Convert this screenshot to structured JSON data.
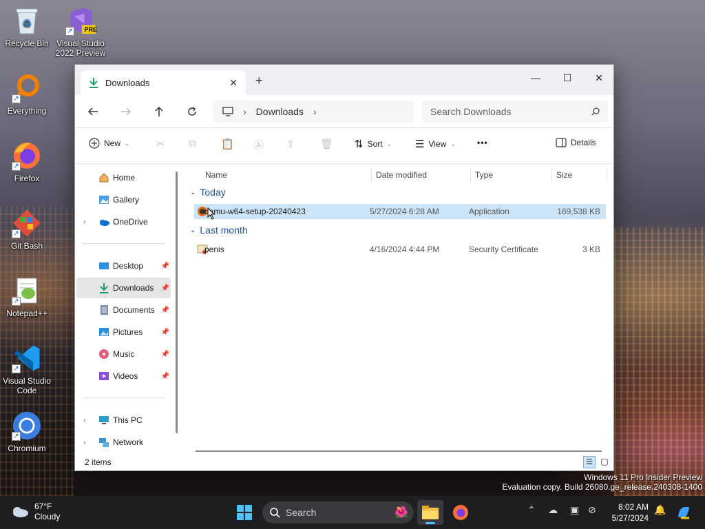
{
  "desktop": {
    "icons": [
      {
        "label": "Recycle Bin",
        "icon": "recycle-bin-icon"
      },
      {
        "label": "Visual Studio 2022 Preview",
        "icon": "visual-studio-icon",
        "badge": "PRE"
      },
      {
        "label": "Everything",
        "icon": "everything-search-icon"
      },
      {
        "label": "Firefox",
        "icon": "firefox-icon"
      },
      {
        "label": "Git Bash",
        "icon": "git-bash-icon"
      },
      {
        "label": "Notepad++",
        "icon": "notepad-plus-plus-icon"
      },
      {
        "label": "Visual Studio Code",
        "icon": "vscode-icon"
      },
      {
        "label": "Chromium",
        "icon": "chromium-icon"
      }
    ]
  },
  "window": {
    "tab_label": "Downloads",
    "tab_close": "✕",
    "new_tab": "+",
    "controls": {
      "minimize": "—",
      "maximize": "☐",
      "close": "✕"
    },
    "address": {
      "crumb": "Downloads"
    },
    "search_placeholder": "Search Downloads",
    "toolbar": {
      "new_label": "New",
      "sort_label": "Sort",
      "view_label": "View",
      "more_label": "•••",
      "details_label": "Details"
    },
    "sidebar": {
      "items": [
        {
          "label": "Home",
          "icon": "home-icon"
        },
        {
          "label": "Gallery",
          "icon": "gallery-icon"
        },
        {
          "label": "OneDrive",
          "icon": "onedrive-icon",
          "expandable": true
        },
        {
          "label": "Desktop",
          "icon": "desktop-folder-icon",
          "pinned": true
        },
        {
          "label": "Downloads",
          "icon": "downloads-folder-icon",
          "pinned": true,
          "selected": true
        },
        {
          "label": "Documents",
          "icon": "documents-folder-icon",
          "pinned": true
        },
        {
          "label": "Pictures",
          "icon": "pictures-folder-icon",
          "pinned": true
        },
        {
          "label": "Music",
          "icon": "music-folder-icon",
          "pinned": true
        },
        {
          "label": "Videos",
          "icon": "videos-folder-icon",
          "pinned": true
        },
        {
          "label": "This PC",
          "icon": "this-pc-icon",
          "expandable": true
        },
        {
          "label": "Network",
          "icon": "network-icon",
          "expandable": true
        }
      ]
    },
    "columns": [
      "Name",
      "Date modified",
      "Type",
      "Size"
    ],
    "groups": [
      {
        "label": "Today",
        "files": [
          {
            "name": "qemu-w64-setup-20240423",
            "date": "5/27/2024 6:28 AM",
            "type": "Application",
            "size": "169,538 KB",
            "icon": "qemu-installer-icon",
            "selected": true
          }
        ]
      },
      {
        "label": "Last month",
        "files": [
          {
            "name": "penis",
            "date": "4/16/2024 4:44 PM",
            "type": "Security Certificate",
            "size": "3 KB",
            "icon": "certificate-icon"
          }
        ]
      }
    ],
    "status_text": "2 items"
  },
  "watermark": {
    "line1": "Windows 11 Pro Insider Preview",
    "line2": "Evaluation copy. Build 26080.ge_release.240308-1400"
  },
  "taskbar": {
    "weather_temp": "67°F",
    "weather_desc": "Cloudy",
    "search_placeholder": "Search",
    "time": "8:02 AM",
    "date": "5/27/2024"
  },
  "colors": {
    "accent": "#0067c0",
    "selection": "#cce4f7",
    "taskbar": "#1f1f22"
  }
}
